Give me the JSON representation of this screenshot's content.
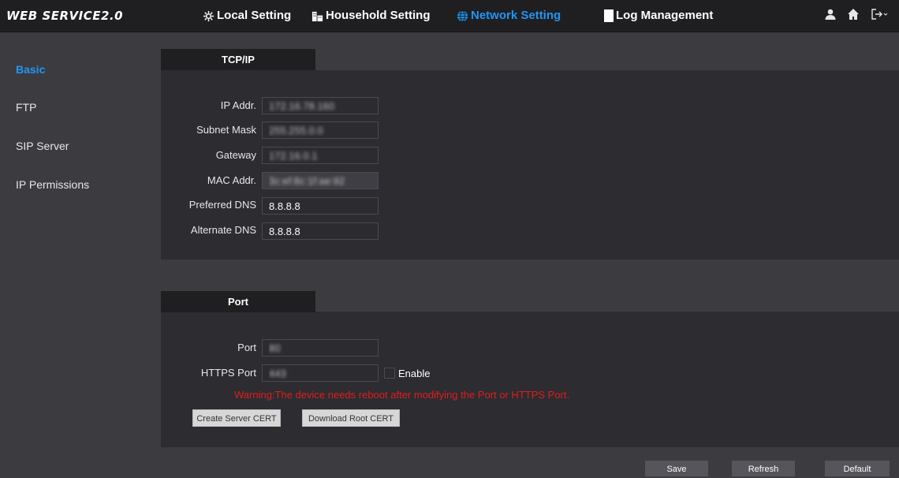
{
  "brand": "WEB SERVICE2.0",
  "nav": {
    "local": "Local Setting",
    "household": "Household Setting",
    "network": "Network Setting",
    "log": "Log Management"
  },
  "sidebar": [
    "Basic",
    "FTP",
    "SIP Server",
    "IP Permissions"
  ],
  "tcpip": {
    "tab": "TCP/IP",
    "ip_label": "IP Addr.",
    "ip_value": "172.16.78.160",
    "subnet_label": "Subnet Mask",
    "subnet_value": "255.255.0.0",
    "gateway_label": "Gateway",
    "gateway_value": "172.16.0.1",
    "mac_label": "MAC Addr.",
    "mac_value": "3c:ef:8c:1f:ae:92",
    "pdns_label": "Preferred DNS",
    "pdns_value": "8.8.8.8",
    "adns_label": "Alternate DNS",
    "adns_value": "8.8.8.8"
  },
  "port": {
    "tab": "Port",
    "port_label": "Port",
    "port_value": "80",
    "https_label": "HTTPS Port",
    "https_value": "443",
    "enable_label": "Enable",
    "warning": "Warning:The device needs reboot after modifying the Port or HTTPS Port.",
    "create_cert": "Create Server CERT",
    "download_cert": "Download Root CERT"
  },
  "buttons": {
    "save": "Save",
    "refresh": "Refresh",
    "default": "Default"
  },
  "colors": {
    "accent": "#2196f3",
    "warning": "#e11d1d",
    "background": "#3b3b40",
    "panel": "#2c2c31",
    "header": "#1f1f22",
    "bottom_button": "#55555b"
  },
  "icons": [
    "gear-icon",
    "building-icon",
    "globe-icon",
    "log-icon",
    "user-icon",
    "home-icon",
    "logout-icon"
  ]
}
